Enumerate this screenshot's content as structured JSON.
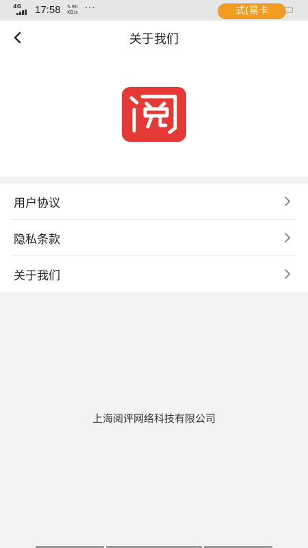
{
  "status_bar": {
    "network": "4G",
    "time": "17:58",
    "speed_value": "5.90",
    "speed_unit": "KB/s",
    "dots": "···",
    "pill_text": "式(易卡",
    "pill_color": "#f39c1f"
  },
  "header": {
    "back_icon": "chevron-left-icon",
    "title": "关于我们"
  },
  "logo": {
    "icon": "app-logo-icon",
    "color": "#e53935"
  },
  "menu": {
    "items": [
      {
        "label": "用户协议",
        "icon": "chevron-right-icon"
      },
      {
        "label": "隐私条款",
        "icon": "chevron-right-icon"
      },
      {
        "label": "关于我们",
        "icon": "chevron-right-icon"
      }
    ]
  },
  "footer": {
    "company": "上海阅评网络科技有限公司"
  }
}
